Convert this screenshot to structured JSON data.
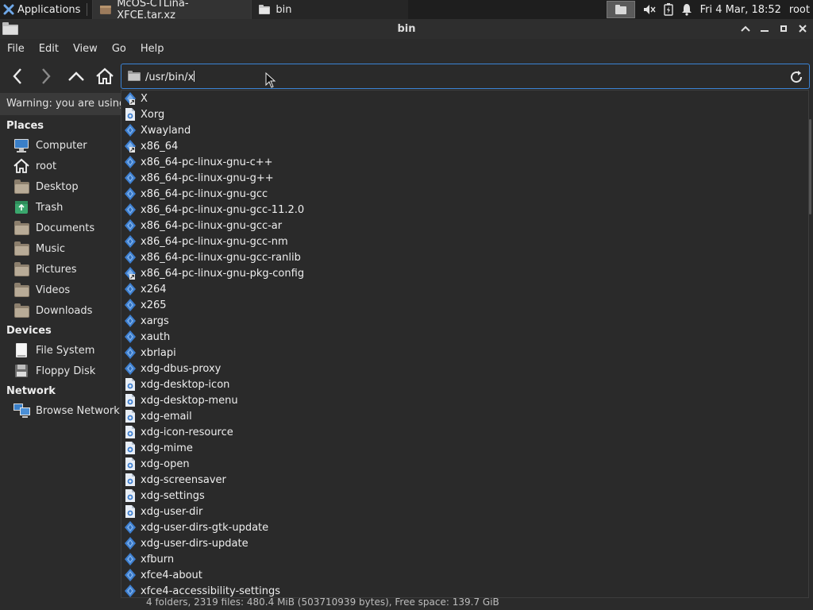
{
  "panel": {
    "apps_label": "Applications",
    "tasks": [
      {
        "label": "McOS-CTLina-XFCE.tar.xz"
      },
      {
        "label": "bin"
      }
    ],
    "clock": "Fri  4 Mar, 18:52",
    "user": "root"
  },
  "window": {
    "title": "bin"
  },
  "menubar": [
    "File",
    "Edit",
    "View",
    "Go",
    "Help"
  ],
  "location": {
    "path": "/usr/bin/x"
  },
  "warning": "Warning: you are using the root account",
  "sidebar": {
    "sections": [
      {
        "title": "Places",
        "items": [
          {
            "label": "Computer",
            "icon": "computer-icon"
          },
          {
            "label": "root",
            "icon": "home-icon"
          },
          {
            "label": "Desktop",
            "icon": "folder-icon"
          },
          {
            "label": "Trash",
            "icon": "trash-icon"
          },
          {
            "label": "Documents",
            "icon": "folder-icon"
          },
          {
            "label": "Music",
            "icon": "folder-icon"
          },
          {
            "label": "Pictures",
            "icon": "folder-icon"
          },
          {
            "label": "Videos",
            "icon": "folder-icon"
          },
          {
            "label": "Downloads",
            "icon": "folder-icon"
          }
        ]
      },
      {
        "title": "Devices",
        "items": [
          {
            "label": "File System",
            "icon": "drive-icon"
          },
          {
            "label": "Floppy Disk",
            "icon": "floppy-icon"
          }
        ]
      },
      {
        "title": "Network",
        "items": [
          {
            "label": "Browse Network",
            "icon": "network-icon"
          }
        ]
      }
    ]
  },
  "completions": [
    {
      "name": "X",
      "kind": "link"
    },
    {
      "name": "Xorg",
      "kind": "script"
    },
    {
      "name": "Xwayland",
      "kind": "binary"
    },
    {
      "name": "x86_64",
      "kind": "link"
    },
    {
      "name": "x86_64-pc-linux-gnu-c++",
      "kind": "binary"
    },
    {
      "name": "x86_64-pc-linux-gnu-g++",
      "kind": "binary"
    },
    {
      "name": "x86_64-pc-linux-gnu-gcc",
      "kind": "binary"
    },
    {
      "name": "x86_64-pc-linux-gnu-gcc-11.2.0",
      "kind": "binary"
    },
    {
      "name": "x86_64-pc-linux-gnu-gcc-ar",
      "kind": "binary"
    },
    {
      "name": "x86_64-pc-linux-gnu-gcc-nm",
      "kind": "binary"
    },
    {
      "name": "x86_64-pc-linux-gnu-gcc-ranlib",
      "kind": "binary"
    },
    {
      "name": "x86_64-pc-linux-gnu-pkg-config",
      "kind": "link"
    },
    {
      "name": "x264",
      "kind": "binary"
    },
    {
      "name": "x265",
      "kind": "binary"
    },
    {
      "name": "xargs",
      "kind": "binary"
    },
    {
      "name": "xauth",
      "kind": "binary"
    },
    {
      "name": "xbrlapi",
      "kind": "binary"
    },
    {
      "name": "xdg-dbus-proxy",
      "kind": "binary"
    },
    {
      "name": "xdg-desktop-icon",
      "kind": "script"
    },
    {
      "name": "xdg-desktop-menu",
      "kind": "script"
    },
    {
      "name": "xdg-email",
      "kind": "script"
    },
    {
      "name": "xdg-icon-resource",
      "kind": "script"
    },
    {
      "name": "xdg-mime",
      "kind": "script"
    },
    {
      "name": "xdg-open",
      "kind": "script"
    },
    {
      "name": "xdg-screensaver",
      "kind": "script"
    },
    {
      "name": "xdg-settings",
      "kind": "script"
    },
    {
      "name": "xdg-user-dir",
      "kind": "script"
    },
    {
      "name": "xdg-user-dirs-gtk-update",
      "kind": "binary"
    },
    {
      "name": "xdg-user-dirs-update",
      "kind": "binary"
    },
    {
      "name": "xfburn",
      "kind": "binary"
    },
    {
      "name": "xfce4-about",
      "kind": "binary"
    },
    {
      "name": "xfce4-accessibility-settings",
      "kind": "binary"
    }
  ],
  "status": "4 folders, 2319 files: 480.4 MiB (503710939 bytes), Free space: 139.7 GiB",
  "colors": {
    "accent": "#3b84d6",
    "binary_icon": "#3d7fd1",
    "script_icon": "#e8eef6"
  }
}
